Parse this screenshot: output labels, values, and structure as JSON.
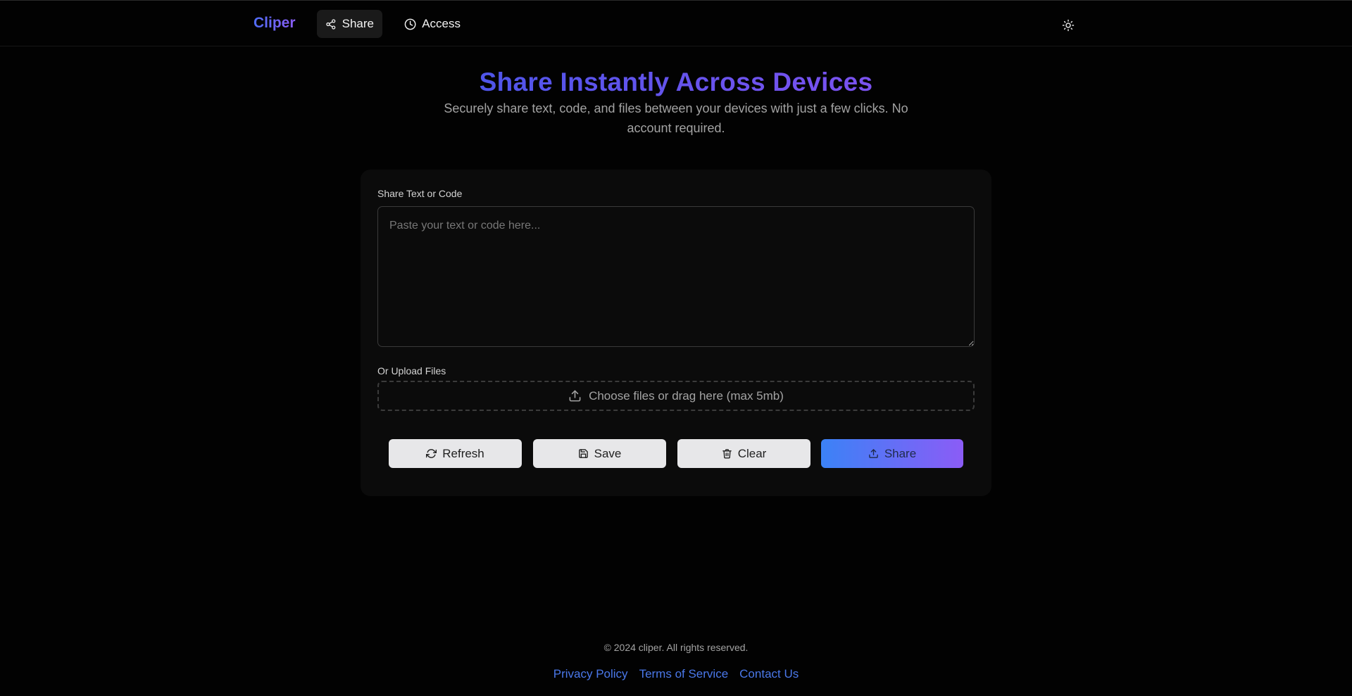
{
  "header": {
    "brand": "Cliper",
    "nav": [
      {
        "label": "Share",
        "icon": "share-icon",
        "active": true
      },
      {
        "label": "Access",
        "icon": "clock-icon",
        "active": false
      }
    ],
    "theme_toggle_icon": "sun-icon"
  },
  "hero": {
    "title": "Share Instantly Across Devices",
    "subtitle": "Securely share text, code, and files between your devices with just a few clicks. No account required."
  },
  "form": {
    "text_label": "Share Text or Code",
    "text_placeholder": "Paste your text or code here...",
    "text_value": "",
    "upload_label": "Or Upload Files",
    "upload_prompt": "Choose files or drag here (max 5mb)",
    "buttons": {
      "refresh": "Refresh",
      "save": "Save",
      "clear": "Clear",
      "share": "Share"
    }
  },
  "footer": {
    "copyright": "© 2024 cliper. All rights reserved.",
    "links": [
      "Privacy Policy",
      "Terms of Service",
      "Contact Us"
    ]
  },
  "colors": {
    "background": "#020202",
    "card": "#0b0b0b",
    "accent_start": "#3b82f6",
    "accent_end": "#8b5cf6",
    "link": "#4a78ea"
  }
}
